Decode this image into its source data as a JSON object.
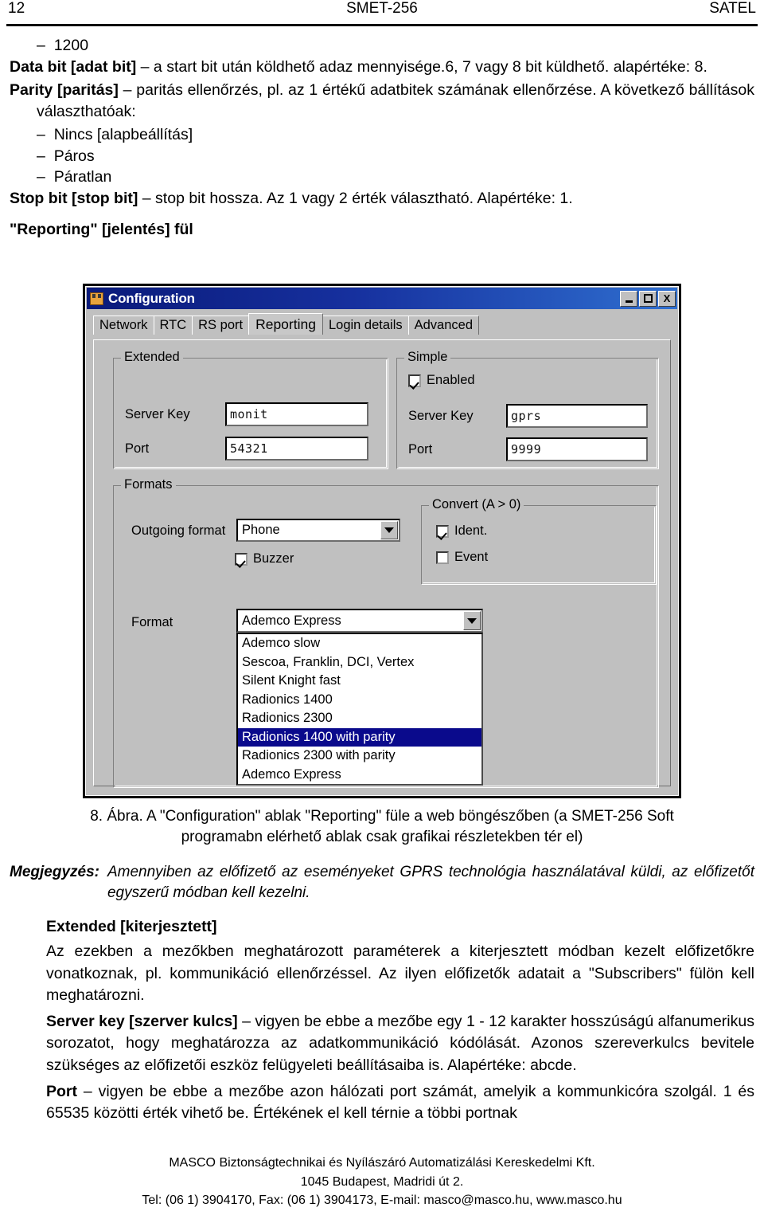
{
  "header": {
    "page_number": "12",
    "doc_title": "SMET-256",
    "brand": "SATEL"
  },
  "body": {
    "bullet_1200": "1200",
    "data_bit_bold": "Data bit [adat bit]",
    "data_bit_rest": " – a start bit után köldhető adaz mennyisége.6, 7 vagy 8 bit küldhető. alapértéke: 8.",
    "parity_bold": "Parity [paritás]",
    "parity_rest": " – paritás ellenőrzés, pl. az 1 értékű adatbitek számának ellenőrzése. A következő bállítások választhatóak:",
    "parity_options": [
      "Nincs [alapbeállítás]",
      "Páros",
      "Páratlan"
    ],
    "stop_bit_bold": "Stop bit [stop bit]",
    "stop_bit_rest": " – stop bit hossza. Az 1 vagy 2 érték választható. Alapértéke: 1.",
    "section_title": "\"Reporting\" [jelentés] fül"
  },
  "dialog": {
    "title": "Configuration",
    "window_buttons": {
      "minimize": "_",
      "maximize": "□",
      "close": "X"
    },
    "tabs": [
      {
        "label": "Network",
        "active": false
      },
      {
        "label": "RTC",
        "active": false
      },
      {
        "label": "RS port",
        "active": false
      },
      {
        "label": "Reporting",
        "active": true
      },
      {
        "label": "Login details",
        "active": false
      },
      {
        "label": "Advanced",
        "active": false
      }
    ],
    "extended": {
      "legend": "Extended",
      "server_key_label": "Server Key",
      "server_key_value": "monit",
      "port_label": "Port",
      "port_value": "54321"
    },
    "simple": {
      "legend": "Simple",
      "enabled_label": "Enabled",
      "enabled_checked": true,
      "server_key_label": "Server Key",
      "server_key_value": "gprs",
      "port_label": "Port",
      "port_value": "9999"
    },
    "formats": {
      "legend": "Formats",
      "outgoing_label": "Outgoing format",
      "outgoing_value": "Phone",
      "buzzer_label": "Buzzer",
      "buzzer_checked": true,
      "format_label": "Format",
      "format_value": "Ademco Express",
      "format_options": [
        "Ademco slow",
        "Sescoa, Franklin, DCI, Vertex",
        "Silent Knight fast",
        "Radionics 1400",
        "Radionics 2300",
        "Radionics 1400 with parity",
        "Radionics 2300 with parity",
        "Ademco Express"
      ],
      "format_selected_index": 5
    },
    "convert": {
      "legend": "Convert (A > 0)",
      "ident_label": "Ident.",
      "ident_checked": true,
      "event_label": "Event",
      "event_checked": false
    },
    "colors": {
      "titlebar_left": "#0a1a7a",
      "titlebar_right": "#2f6fd0",
      "face": "#c0c0c0",
      "selection": "#0a0a8c"
    }
  },
  "caption": {
    "line1": "8. Ábra. A \"Configuration\" ablak \"Reporting\" füle a web böngészőben (a SMET-256 Soft",
    "line2": "programabn elérhető ablak csak grafikai részletekben tér el)"
  },
  "note": {
    "label": "Megjegyzés:",
    "text": "Amennyiben az előfizető az eseményeket GPRS technológia használatával küldi, az előfizetőt egyszerű módban kell kezelni."
  },
  "tail": {
    "extended_heading": "Extended [kiterjesztett]",
    "extended_para": "Az ezekben a mezőkben meghatározott paraméterek a kiterjesztett módban kezelt előfizetőkre vonatkoznak, pl. kommunikáció ellenőrzéssel. Az ilyen előfizetők adatait a \"Subscribers\" fülön kell meghatározni.",
    "server_key_bold": "Server key [szerver kulcs]",
    "server_key_rest": " – vigyen be ebbe a mezőbe egy 1 - 12 karakter hosszúságú alfanumerikus sorozatot, hogy meghatározza az adatkommunikáció kódólását. Azonos szereverkulcs bevitele szükséges az előfizetői eszköz felügyeleti beállításaiba is. Alapértéke: abcde.",
    "port_bold": "Port",
    "port_rest": " – vigyen be ebbe a mezőbe azon hálózati port számát, amelyik a kommunkicóra szolgál. 1 és 65535 közötti érték vihető be. Értékének el kell térnie a többi portnak"
  },
  "footer": {
    "line1": "MASCO Biztonságtechnikai és Nyílászáró Automatizálási Kereskedelmi Kft.",
    "line2": "1045 Budapest, Madridi út 2.",
    "line3": "Tel: (06 1) 3904170, Fax: (06 1) 3904173, E-mail: masco@masco.hu, www.masco.hu"
  }
}
